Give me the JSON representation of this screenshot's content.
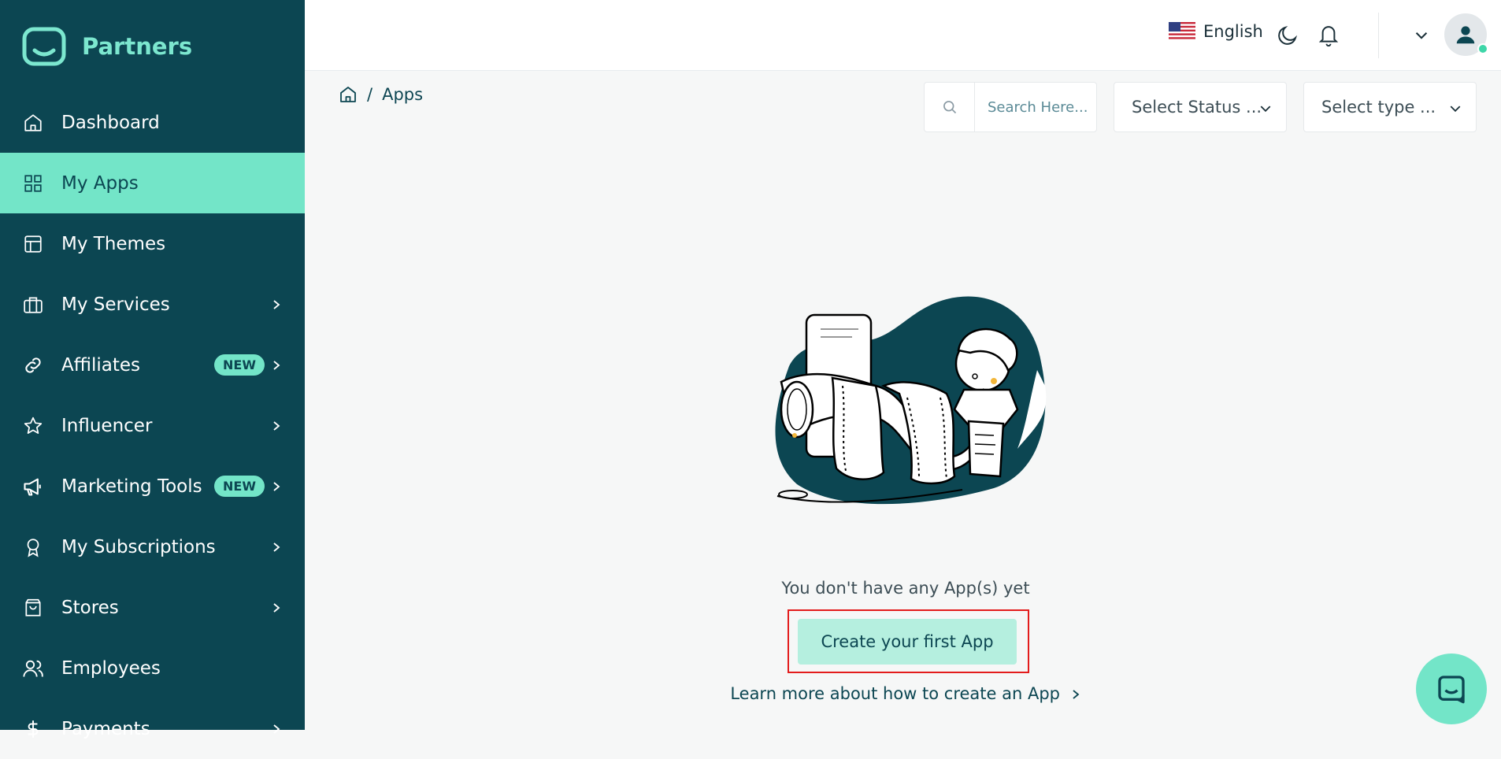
{
  "brand": {
    "name": "Partners"
  },
  "sidebar": {
    "items": [
      {
        "label": "Dashboard",
        "icon": "home-icon"
      },
      {
        "label": "My Apps",
        "icon": "grid-icon",
        "active": true
      },
      {
        "label": "My Themes",
        "icon": "layout-icon"
      },
      {
        "label": "My Services",
        "icon": "briefcase-icon",
        "chevron": true
      },
      {
        "label": "Affiliates",
        "icon": "link-icon",
        "badge": "NEW",
        "chevron": true
      },
      {
        "label": "Influencer",
        "icon": "star-icon",
        "chevron": true
      },
      {
        "label": "Marketing Tools",
        "icon": "megaphone-icon",
        "badge": "NEW",
        "chevron": true
      },
      {
        "label": "My Subscriptions",
        "icon": "award-icon",
        "chevron": true
      },
      {
        "label": "Stores",
        "icon": "shopping-bag-icon",
        "chevron": true
      },
      {
        "label": "Employees",
        "icon": "users-icon"
      },
      {
        "label": "Payments",
        "icon": "dollar-icon",
        "chevron": true
      }
    ]
  },
  "topbar": {
    "language": "English"
  },
  "breadcrumb": {
    "current": "Apps",
    "separator": "/"
  },
  "filters": {
    "search_placeholder": "Search Here...",
    "status_label": "Select Status ...",
    "type_label": "Select type ..."
  },
  "empty_state": {
    "message": "You don't have any App(s) yet",
    "create_button": "Create your first App",
    "learn_more": "Learn more about how to create an App"
  },
  "colors": {
    "sidebar_bg": "#0c4652",
    "accent": "#73e5c8",
    "button_bg": "#b5efdf",
    "highlight_outline": "#e31c1c"
  }
}
